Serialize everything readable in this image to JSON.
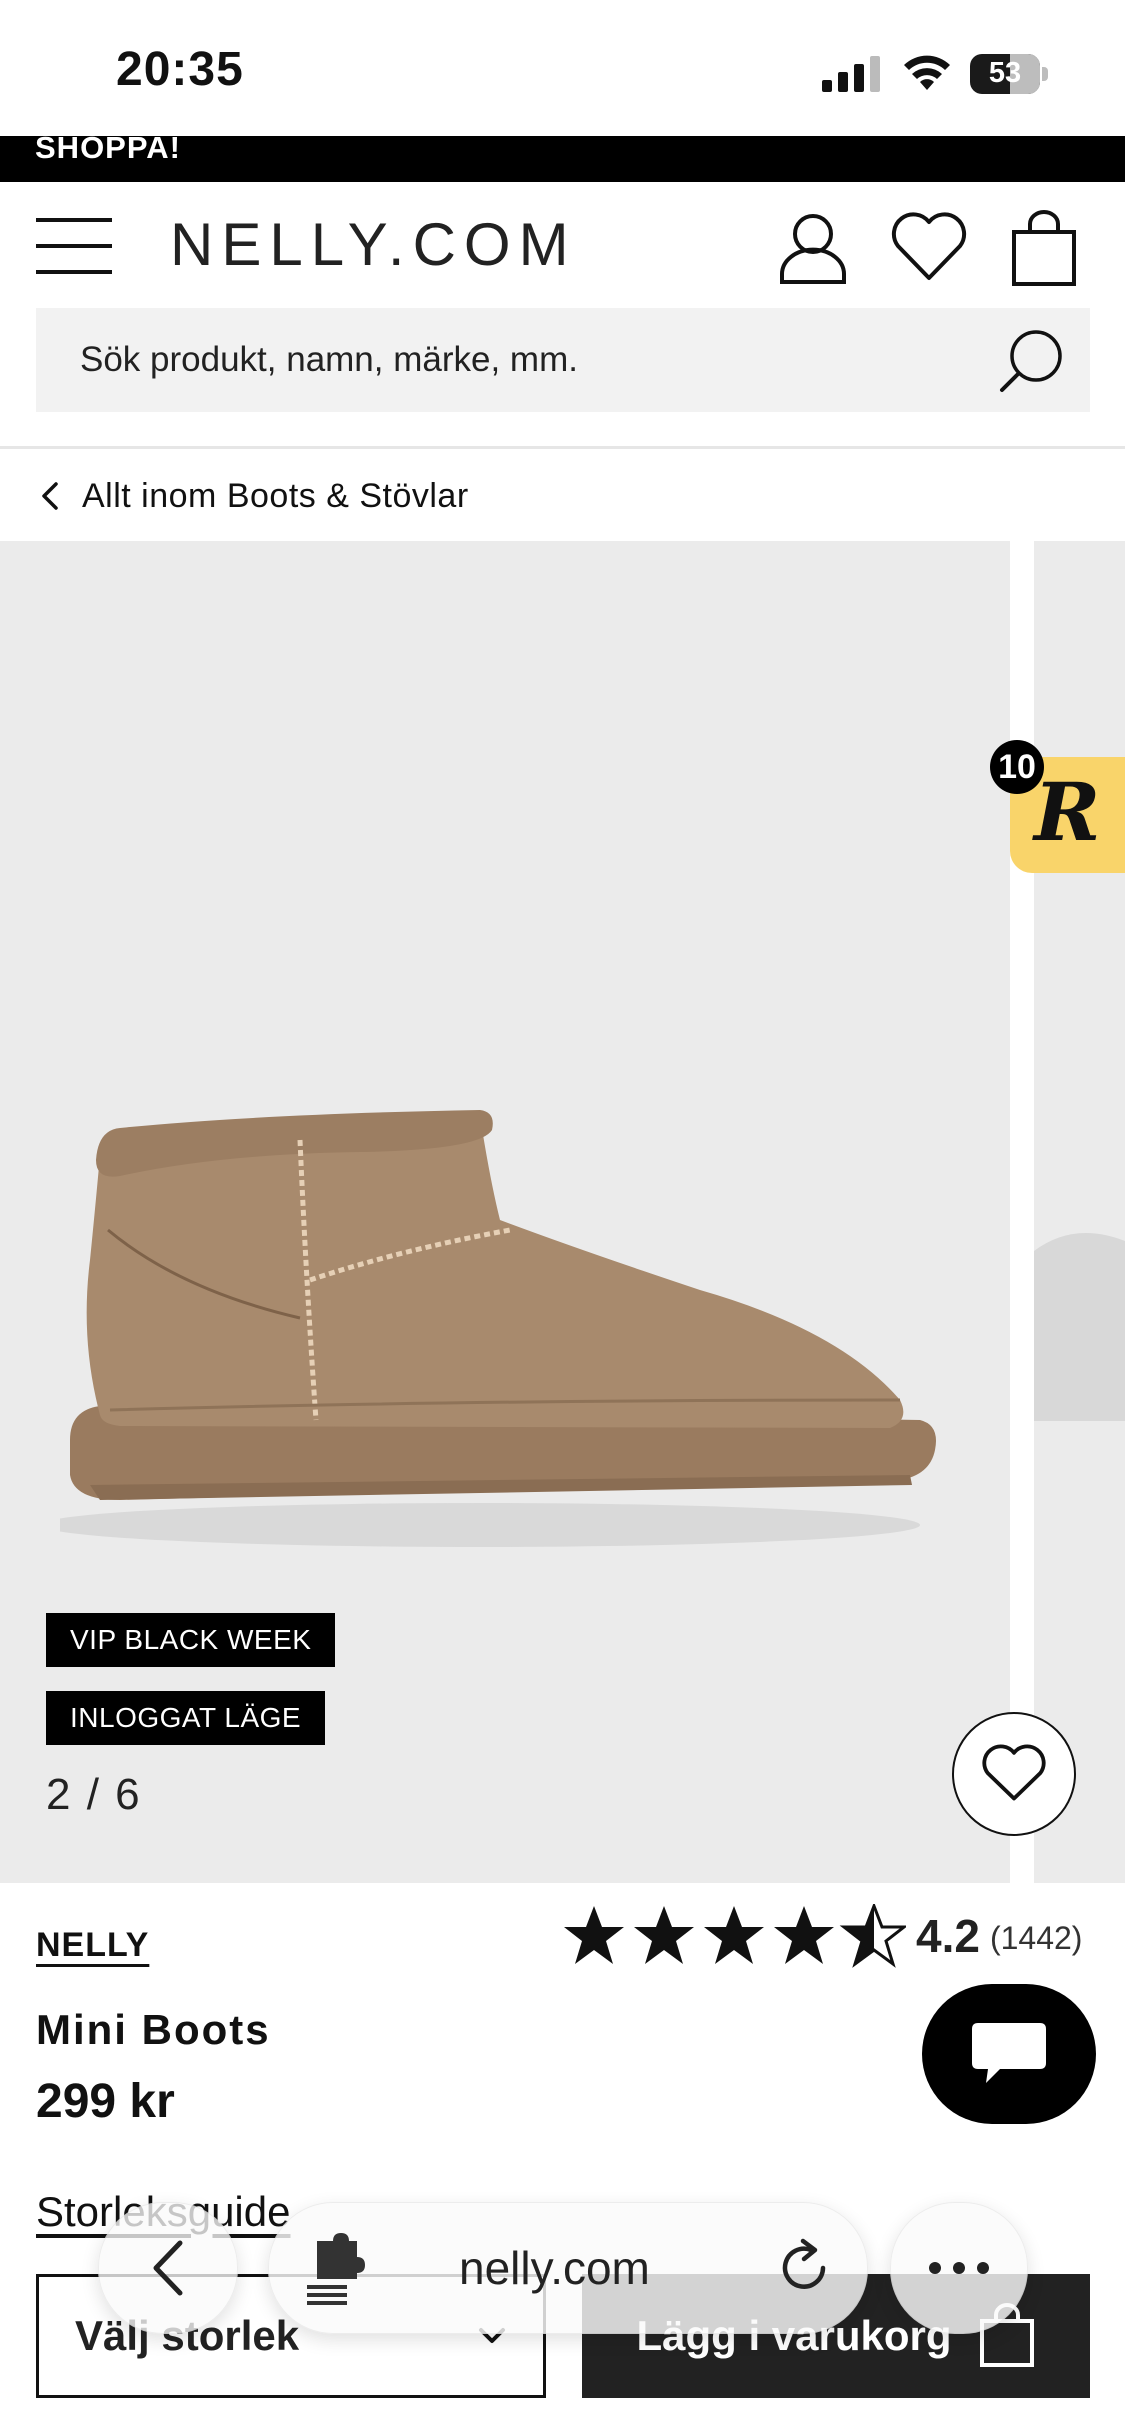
{
  "status_bar": {
    "time": "20:35",
    "battery": "53"
  },
  "promo": {
    "text": "SHOPPA!"
  },
  "header": {
    "logo": "NELLY.COM"
  },
  "search": {
    "placeholder": "Sök produkt, namn, märke, mm."
  },
  "breadcrumb": {
    "label": "Allt inom Boots & Stövlar"
  },
  "gallery": {
    "badges": [
      "VIP BLACK WEEK",
      "INLOGGAT LÄGE"
    ],
    "counter": "2 / 6",
    "widget_count": "10",
    "widget_letter": "R"
  },
  "product": {
    "brand": "NELLY",
    "rating": "4.2",
    "rating_value": 4.2,
    "rating_count": "(1442)",
    "name": "Mini Boots",
    "price": "299 kr"
  },
  "purchase": {
    "size_guide": "Storleksguide",
    "size_select": "Välj storlek",
    "add_to_cart": "Lägg i varukorg"
  },
  "browser": {
    "url": "nelly.com"
  },
  "colors": {
    "brand_black": "#000000",
    "boot": "#a88a6d",
    "gallery_bg": "#ebebeb",
    "widget_yellow": "#f9d46a"
  }
}
